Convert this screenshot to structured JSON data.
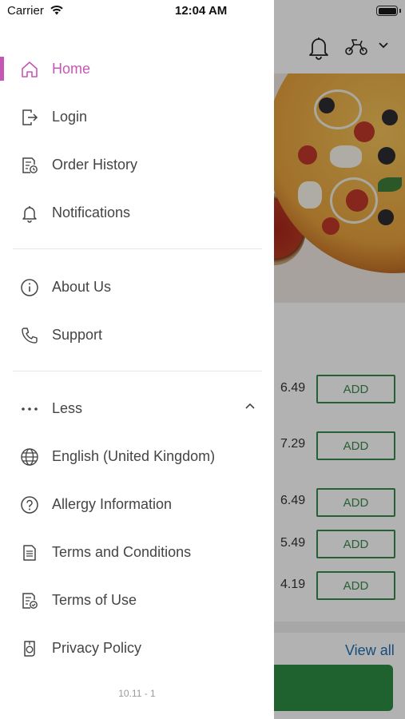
{
  "status_bar": {
    "carrier": "Carrier",
    "time": "12:04 AM"
  },
  "drawer": {
    "primary_items": [
      {
        "label": "Home",
        "icon": "home-icon",
        "active": true
      },
      {
        "label": "Login",
        "icon": "login-icon",
        "active": false
      },
      {
        "label": "Order History",
        "icon": "order-history-icon",
        "active": false
      },
      {
        "label": "Notifications",
        "icon": "bell-icon",
        "active": false
      }
    ],
    "secondary_items": [
      {
        "label": "About Us",
        "icon": "info-icon"
      },
      {
        "label": "Support",
        "icon": "phone-icon"
      }
    ],
    "more_toggle": {
      "label": "Less",
      "icon": "more-dots-icon",
      "expanded": true
    },
    "more_items": [
      {
        "label": "English (United Kingdom)",
        "icon": "globe-icon"
      },
      {
        "label": "Allergy Information",
        "icon": "help-circle-icon"
      },
      {
        "label": "Terms and Conditions",
        "icon": "document-icon"
      },
      {
        "label": "Terms of Use",
        "icon": "document-check-icon"
      },
      {
        "label": "Privacy Policy",
        "icon": "privacy-icon"
      }
    ],
    "version": "10.11 - 1"
  },
  "background": {
    "products": [
      {
        "price": "6.49",
        "button": "ADD"
      },
      {
        "price": "7.29",
        "button": "ADD"
      },
      {
        "price": "6.49",
        "button": "ADD"
      },
      {
        "price": "5.49",
        "button": "ADD"
      },
      {
        "price": "4.19",
        "button": "ADD"
      }
    ],
    "view_all": "View all"
  },
  "colors": {
    "accent": "#c556b3",
    "add_button": "#3a8a4e",
    "view_all_link": "#1f6fb0",
    "cta_button": "#2e8b46"
  }
}
